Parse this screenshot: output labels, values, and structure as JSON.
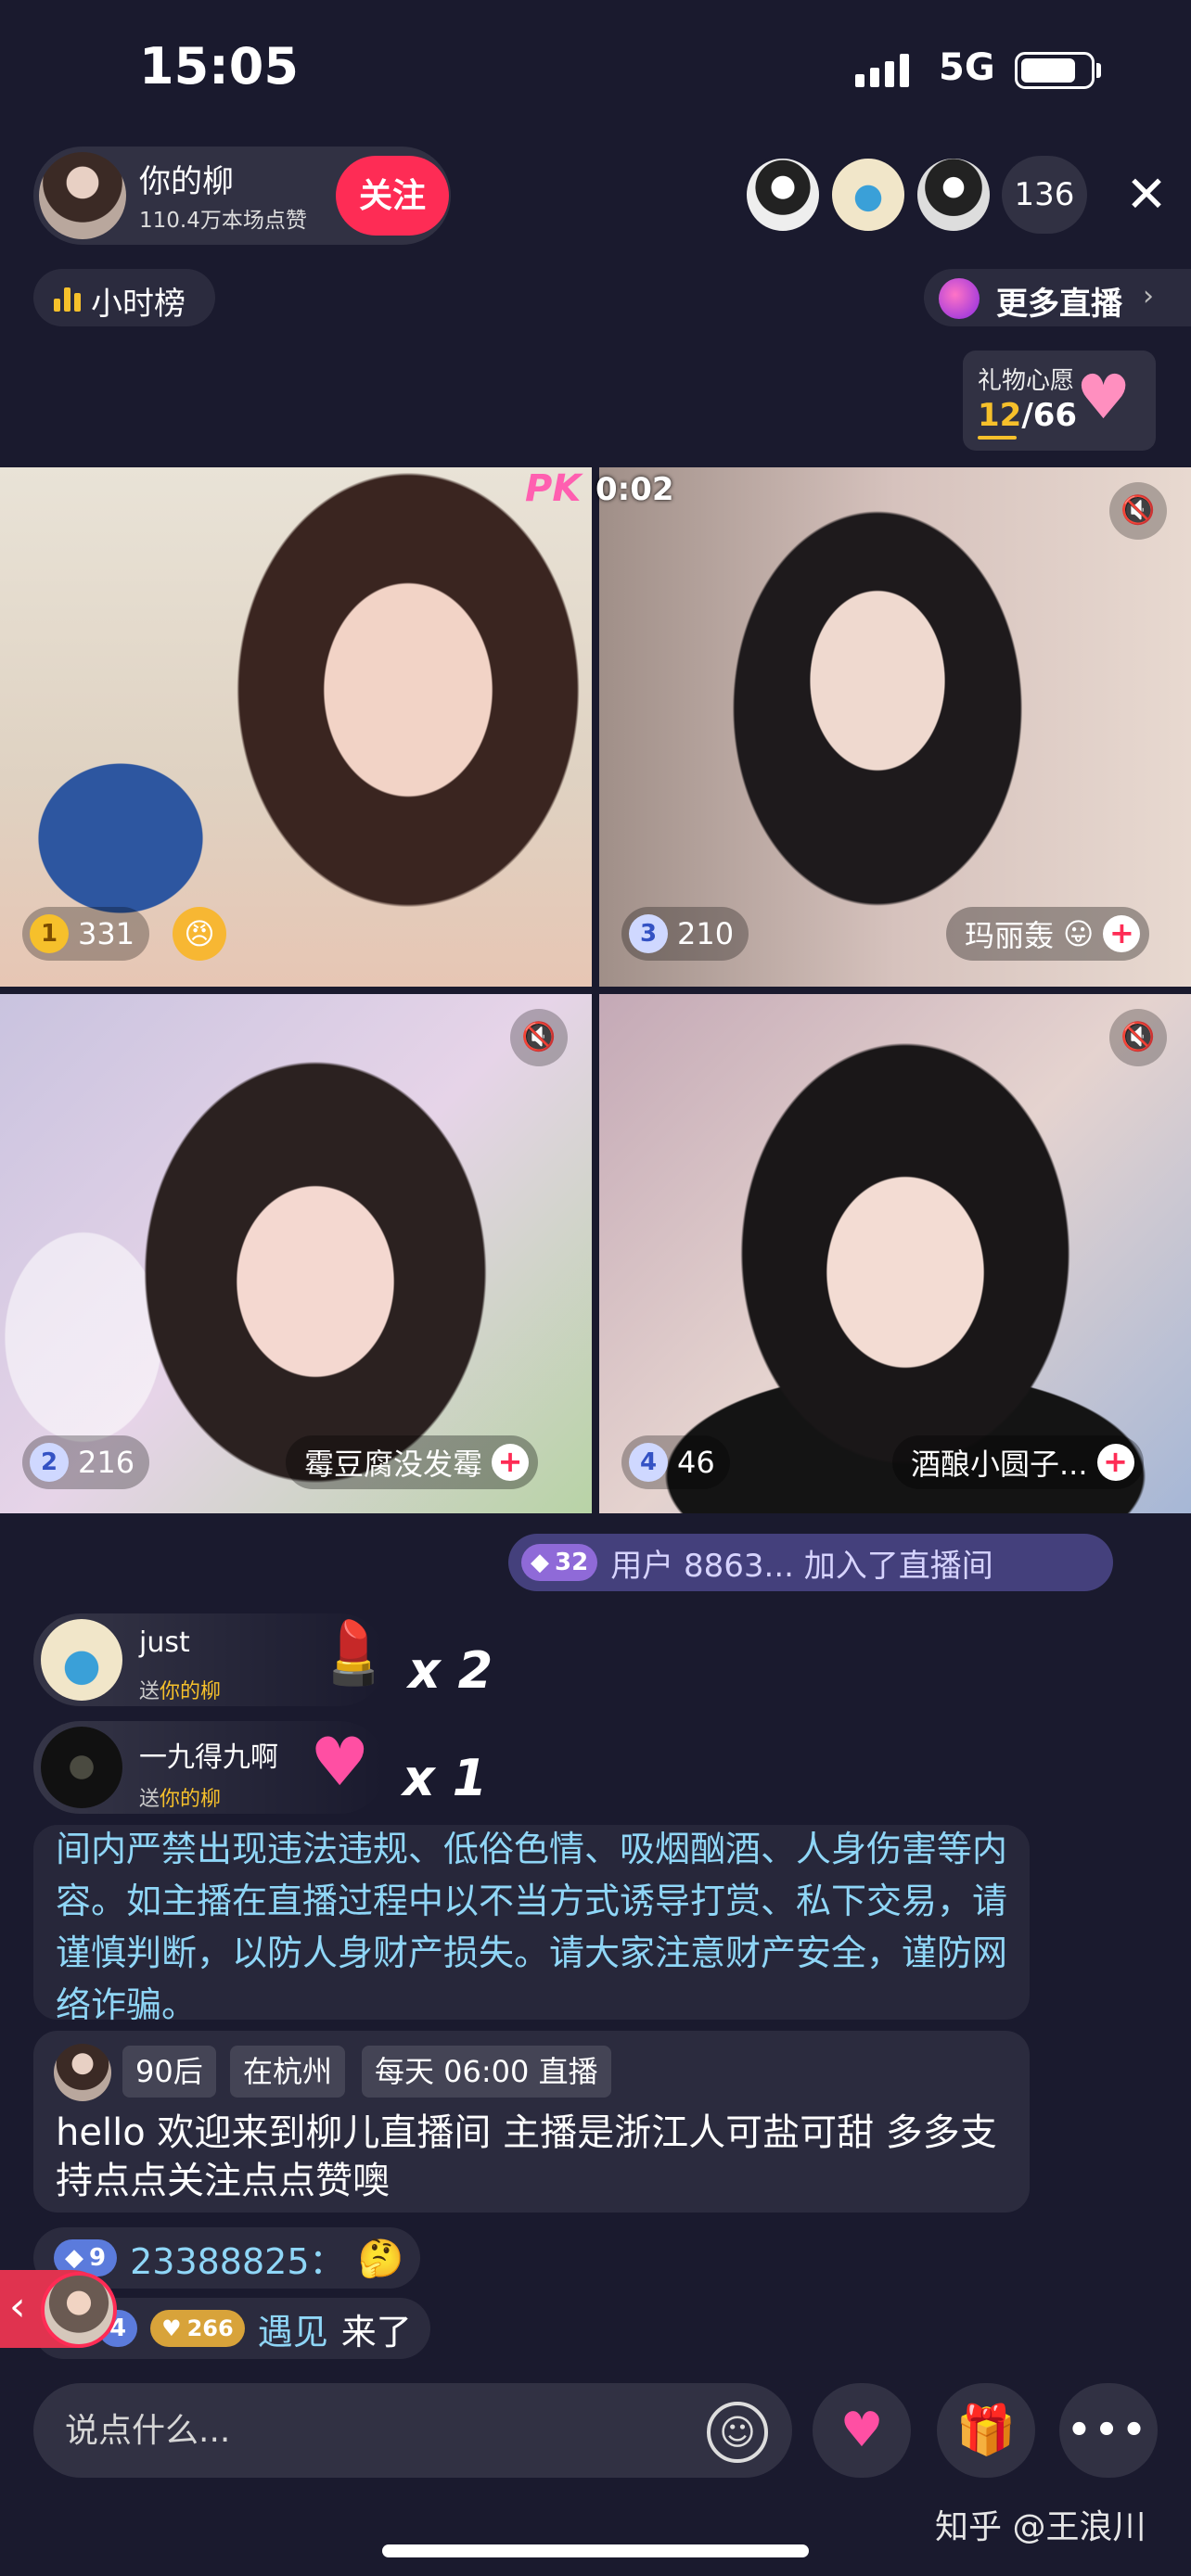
{
  "status_bar": {
    "time": "15:05",
    "network": "5G"
  },
  "host": {
    "name": "你的柳",
    "likes": "110.4万本场点赞",
    "follow_label": "关注"
  },
  "viewers": {
    "count": "136"
  },
  "rank": {
    "label": "小时榜"
  },
  "more_live": {
    "label": "更多直播"
  },
  "gift_wish": {
    "title": "礼物心愿",
    "current": "12",
    "total": "/66"
  },
  "pk": {
    "badge": "PK",
    "timer": "0:02"
  },
  "tiles": [
    {
      "rank": "1",
      "score": "331",
      "name": ""
    },
    {
      "rank": "3",
      "score": "210",
      "name": "玛丽轰"
    },
    {
      "rank": "2",
      "score": "216",
      "name": "霉豆腐没发霉"
    },
    {
      "rank": "4",
      "score": "46",
      "name": "酒酿小圆子..."
    }
  ],
  "join_notice": {
    "level": "32",
    "text": "用户 8863... 加入了直播间"
  },
  "gift_messages": [
    {
      "user": "just",
      "to_prefix": "送",
      "to_name": "你的柳",
      "multiplier": "x 2"
    },
    {
      "user": "一九得九啊",
      "to_prefix": "送",
      "to_name": "你的柳",
      "multiplier": "x 1"
    }
  ],
  "system_notice": "间内严禁出现违法违规、低俗色情、吸烟酗酒、人身伤害等内容。如主播在直播过程中以不当方式诱导打赏、私下交易，请谨慎判断，以防人身财产损失。请大家注意财产安全，谨防网络诈骗。",
  "host_greeting": {
    "tags": [
      "90后",
      "在杭州",
      "每天 06:00 直播"
    ],
    "text": "hello 欢迎来到柳儿直播间 主播是浙江人可盐可甜 多多支持点点关注点点赞噢"
  },
  "chat": [
    {
      "badge": "9",
      "user": "23388825："
    },
    {
      "badge": "4",
      "gold": "266",
      "user": "遇见",
      "action": " 来了"
    }
  ],
  "comment": {
    "placeholder": "说点什么..."
  },
  "bottom_more": "•••",
  "watermark": "知乎 @王浪川"
}
